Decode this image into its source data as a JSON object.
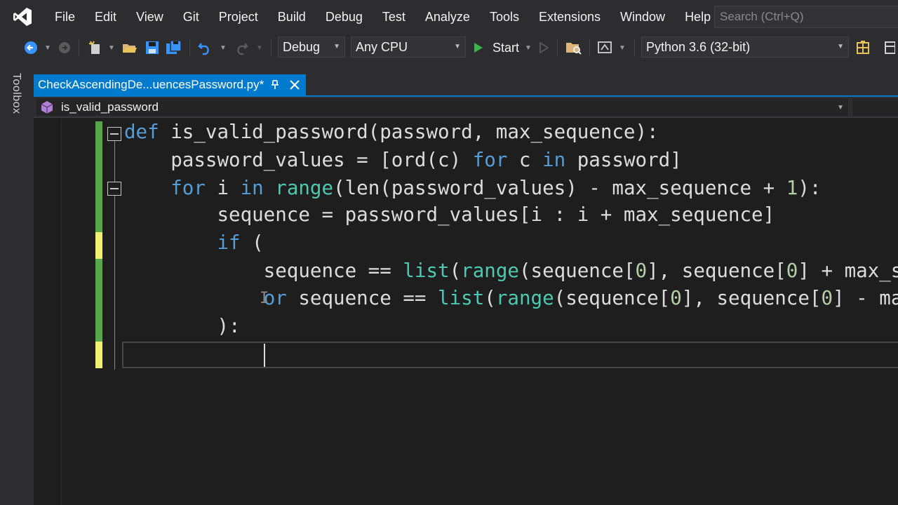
{
  "menu": {
    "items": [
      "File",
      "Edit",
      "View",
      "Git",
      "Project",
      "Build",
      "Debug",
      "Test",
      "Analyze",
      "Tools",
      "Extensions",
      "Window",
      "Help"
    ],
    "search_placeholder": "Search (Ctrl+Q)"
  },
  "toolbar": {
    "configuration": "Debug",
    "platform": "Any CPU",
    "start_label": "Start",
    "environment": "Python 3.6 (32-bit)"
  },
  "sidebar": {
    "toolbox_label": "Toolbox"
  },
  "tab": {
    "title": "CheckAscendingDe...uencesPassword.py*"
  },
  "navbar": {
    "member": "is_valid_password"
  },
  "editor": {
    "lines": [
      [
        {
          "t": "def",
          "c": "kw"
        },
        {
          "t": " is_valid_password(password, max_sequence):",
          "c": "id"
        }
      ],
      [
        {
          "t": "    password_values = [ord(c) ",
          "c": "id"
        },
        {
          "t": "for",
          "c": "kw"
        },
        {
          "t": " c ",
          "c": "id"
        },
        {
          "t": "in",
          "c": "kw"
        },
        {
          "t": " password]",
          "c": "id"
        }
      ],
      [
        {
          "t": "    ",
          "c": "id"
        },
        {
          "t": "for",
          "c": "kw"
        },
        {
          "t": " i ",
          "c": "id"
        },
        {
          "t": "in",
          "c": "kw"
        },
        {
          "t": " ",
          "c": "id"
        },
        {
          "t": "range",
          "c": "fn"
        },
        {
          "t": "(len(password_values) - max_sequence + ",
          "c": "id"
        },
        {
          "t": "1",
          "c": "num"
        },
        {
          "t": "):",
          "c": "id"
        }
      ],
      [
        {
          "t": "        sequence = password_values[i : i + max_sequence]",
          "c": "id"
        }
      ],
      [
        {
          "t": "        ",
          "c": "id"
        },
        {
          "t": "if",
          "c": "kw"
        },
        {
          "t": " (",
          "c": "id"
        }
      ],
      [
        {
          "t": "            sequence == ",
          "c": "id"
        },
        {
          "t": "list",
          "c": "fn"
        },
        {
          "t": "(",
          "c": "id"
        },
        {
          "t": "range",
          "c": "fn"
        },
        {
          "t": "(sequence[",
          "c": "id"
        },
        {
          "t": "0",
          "c": "num"
        },
        {
          "t": "], sequence[",
          "c": "id"
        },
        {
          "t": "0",
          "c": "num"
        },
        {
          "t": "] + max_s",
          "c": "id"
        }
      ],
      [
        {
          "t": "            ",
          "c": "id"
        },
        {
          "t": "or",
          "c": "kw"
        },
        {
          "t": " sequence == ",
          "c": "id"
        },
        {
          "t": "list",
          "c": "fn"
        },
        {
          "t": "(",
          "c": "id"
        },
        {
          "t": "range",
          "c": "fn"
        },
        {
          "t": "(sequence[",
          "c": "id"
        },
        {
          "t": "0",
          "c": "num"
        },
        {
          "t": "], sequence[",
          "c": "id"
        },
        {
          "t": "0",
          "c": "num"
        },
        {
          "t": "] - ma",
          "c": "id"
        }
      ],
      [
        {
          "t": "        ):",
          "c": "id"
        }
      ],
      [
        {
          "t": "",
          "c": "id"
        }
      ]
    ],
    "colors": {
      "keyword": "#569cd6",
      "function": "#4ec9b0",
      "identifier": "#dcdcdc",
      "number": "#b5cea8",
      "saved_change": "#57a64a",
      "unsaved_change": "#efef75",
      "accent": "#007acc"
    }
  }
}
